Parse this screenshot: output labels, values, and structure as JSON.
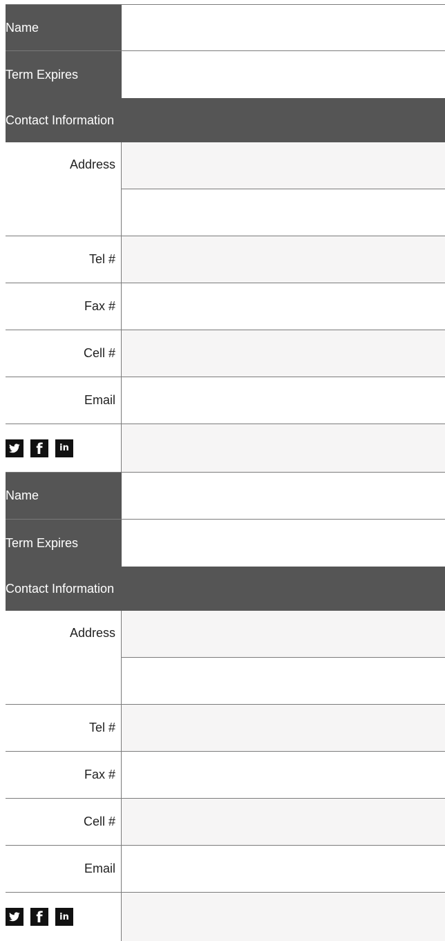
{
  "colors": {
    "header_bg": "#555555",
    "value_bg": "#f6f5f5",
    "rule": "#7a7a7a",
    "icon_bg": "#111111"
  },
  "entries": [
    {
      "name_label": "Name",
      "term_label": "Term Expires",
      "contact_heading": "Contact Information",
      "address_label": "Address",
      "tel_label": "Tel #",
      "fax_label": "Fax #",
      "cell_label": "Cell #",
      "email_label": "Email",
      "social": {
        "twitter": "twitter-icon",
        "facebook_glyph": "f",
        "linkedin_glyph": "in"
      }
    },
    {
      "name_label": "Name",
      "term_label": "Term Expires",
      "contact_heading": "Contact Information",
      "address_label": "Address",
      "tel_label": "Tel #",
      "fax_label": "Fax #",
      "cell_label": "Cell #",
      "email_label": "Email",
      "social": {
        "twitter": "twitter-icon",
        "facebook_glyph": "f",
        "linkedin_glyph": "in"
      }
    }
  ]
}
